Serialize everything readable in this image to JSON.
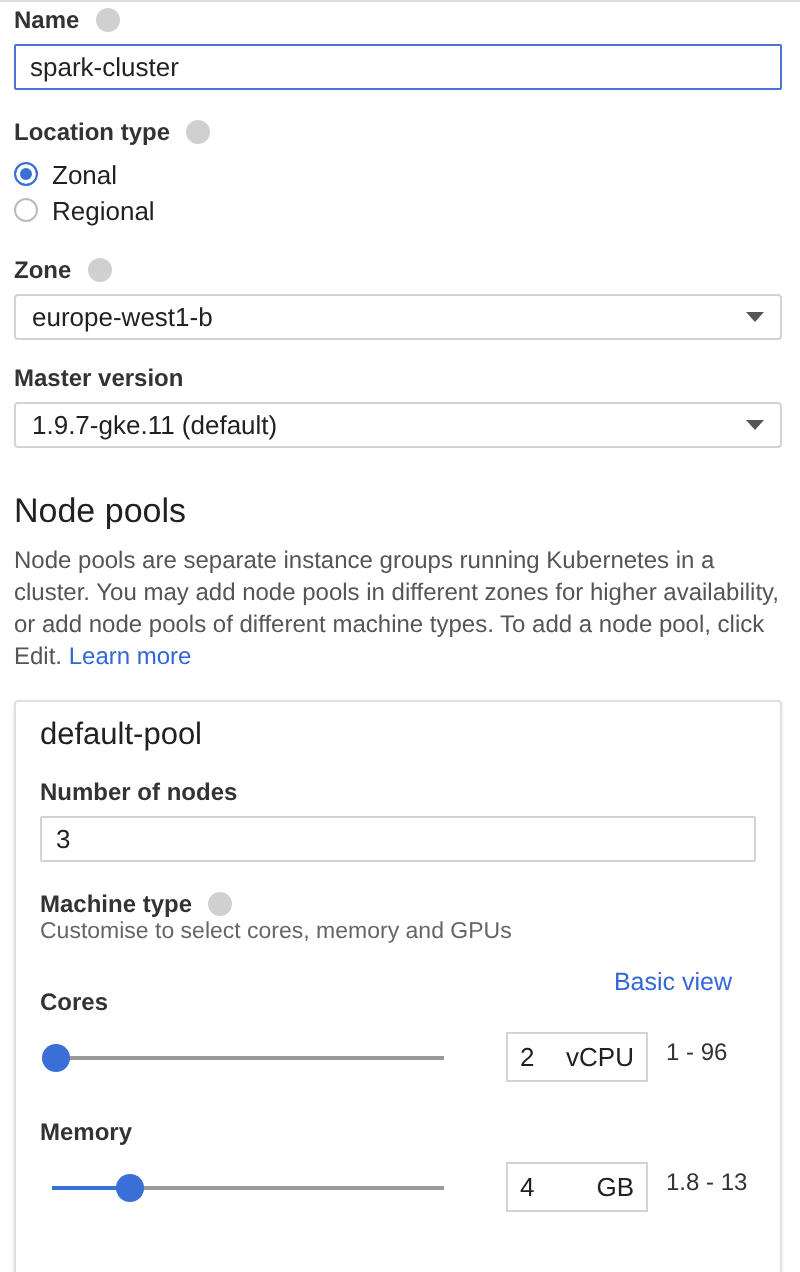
{
  "name_field": {
    "label": "Name",
    "value": "spark-cluster",
    "focused": true
  },
  "location_type": {
    "label": "Location type",
    "options": [
      {
        "label": "Zonal",
        "selected": true
      },
      {
        "label": "Regional",
        "selected": false
      }
    ]
  },
  "zone": {
    "label": "Zone",
    "value": "europe-west1-b"
  },
  "master_version": {
    "label": "Master version",
    "value": "1.9.7-gke.11 (default)"
  },
  "node_pools": {
    "heading": "Node pools",
    "description": "Node pools are separate instance groups running Kubernetes in a cluster. You may add node pools in different zones for higher availability, or add node pools of different machine types. To add a node pool, click Edit.",
    "link": "Learn more",
    "pool": {
      "title": "default-pool",
      "nodes_label": "Number of nodes",
      "nodes_value": "3",
      "machine_type_label": "Machine type",
      "machine_type_hint": "Customise to select cores, memory and GPUs",
      "basic_view": "Basic view",
      "resources": [
        {
          "label": "Cores",
          "level": 0.01,
          "value": "2",
          "unit": "vCPU",
          "range": "1 - 96"
        },
        {
          "label": "Memory",
          "level": 0.2,
          "value": "4",
          "unit": "GB",
          "range": "1.8 - 13"
        }
      ]
    }
  }
}
